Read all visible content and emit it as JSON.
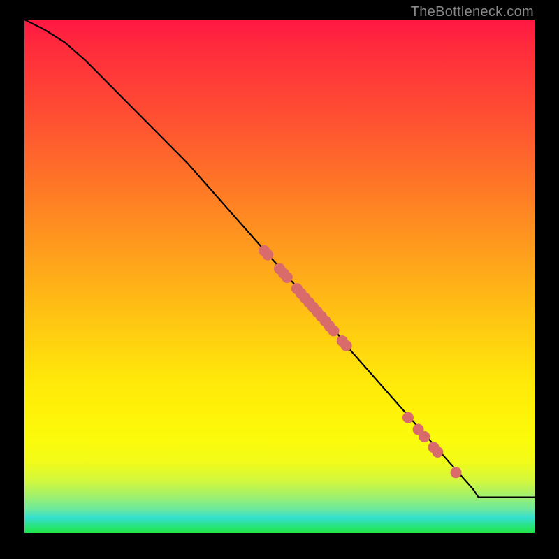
{
  "watermark": "TheBottleneck.com",
  "chart_data": {
    "type": "line",
    "title": "",
    "xlabel": "",
    "ylabel": "",
    "xlim": [
      0,
      100
    ],
    "ylim": [
      0,
      100
    ],
    "line": {
      "x": [
        0,
        4,
        8,
        12,
        16,
        20,
        24,
        28,
        32,
        36,
        40,
        44,
        48,
        52,
        56,
        60,
        64,
        68,
        72,
        76,
        80,
        84,
        88,
        89,
        92,
        96,
        100
      ],
      "y": [
        100,
        98,
        95.5,
        92,
        88,
        84,
        80,
        76,
        72,
        67.5,
        63,
        58.5,
        54,
        49.5,
        45,
        40.5,
        35.5,
        31,
        26.5,
        22,
        17.5,
        13,
        8.5,
        7,
        7,
        7,
        7
      ]
    },
    "markers": {
      "color": "#d96b6b",
      "radius": 8,
      "points": [
        {
          "x": 47.0,
          "y": 55.0
        },
        {
          "x": 47.7,
          "y": 54.2
        },
        {
          "x": 50.0,
          "y": 51.5
        },
        {
          "x": 50.8,
          "y": 50.6
        },
        {
          "x": 51.5,
          "y": 49.8
        },
        {
          "x": 53.4,
          "y": 47.6
        },
        {
          "x": 54.2,
          "y": 46.7
        },
        {
          "x": 55.0,
          "y": 45.8
        },
        {
          "x": 55.8,
          "y": 44.9
        },
        {
          "x": 56.6,
          "y": 44.0
        },
        {
          "x": 57.4,
          "y": 43.1
        },
        {
          "x": 58.2,
          "y": 42.2
        },
        {
          "x": 59.0,
          "y": 41.3
        },
        {
          "x": 59.8,
          "y": 40.3
        },
        {
          "x": 60.6,
          "y": 39.4
        },
        {
          "x": 62.3,
          "y": 37.4
        },
        {
          "x": 63.1,
          "y": 36.5
        },
        {
          "x": 75.2,
          "y": 22.5
        },
        {
          "x": 77.2,
          "y": 20.2
        },
        {
          "x": 78.4,
          "y": 18.8
        },
        {
          "x": 80.2,
          "y": 16.7
        },
        {
          "x": 81.0,
          "y": 15.8
        },
        {
          "x": 84.6,
          "y": 11.8
        }
      ]
    }
  }
}
